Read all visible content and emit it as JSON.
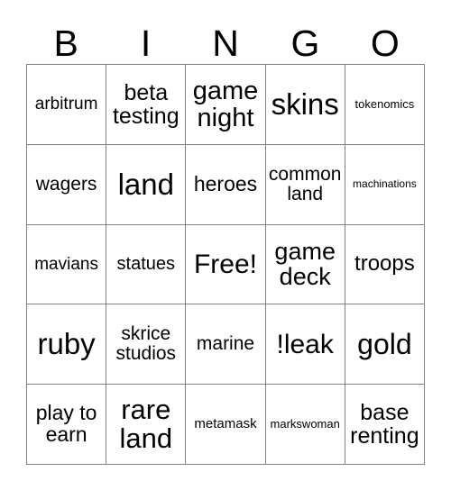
{
  "card": {
    "header": {
      "letters": [
        "B",
        "I",
        "N",
        "G",
        "O"
      ]
    },
    "rows": [
      [
        {
          "label": "arbitrum",
          "size": 19
        },
        {
          "label": "beta\ntesting",
          "size": 25
        },
        {
          "label": "game\nnight",
          "size": 29
        },
        {
          "label": "skins",
          "size": 33
        },
        {
          "label": "tokenomics",
          "size": 13
        }
      ],
      [
        {
          "label": "wagers",
          "size": 21
        },
        {
          "label": "land",
          "size": 33
        },
        {
          "label": "heroes",
          "size": 23
        },
        {
          "label": "common\nland",
          "size": 21
        },
        {
          "label": "machinations",
          "size": 12
        }
      ],
      [
        {
          "label": "mavians",
          "size": 19
        },
        {
          "label": "statues",
          "size": 20
        },
        {
          "label": "Free!",
          "size": 30
        },
        {
          "label": "game\ndeck",
          "size": 27
        },
        {
          "label": "troops",
          "size": 24
        }
      ],
      [
        {
          "label": "ruby",
          "size": 33
        },
        {
          "label": "skrice\nstudios",
          "size": 21
        },
        {
          "label": "marine",
          "size": 21
        },
        {
          "label": "!leak",
          "size": 30
        },
        {
          "label": "gold",
          "size": 32
        }
      ],
      [
        {
          "label": "play to\nearn",
          "size": 23
        },
        {
          "label": "rare\nland",
          "size": 31
        },
        {
          "label": "metamask",
          "size": 15
        },
        {
          "label": "markswoman",
          "size": 13
        },
        {
          "label": "base\nrenting",
          "size": 25
        }
      ]
    ]
  }
}
